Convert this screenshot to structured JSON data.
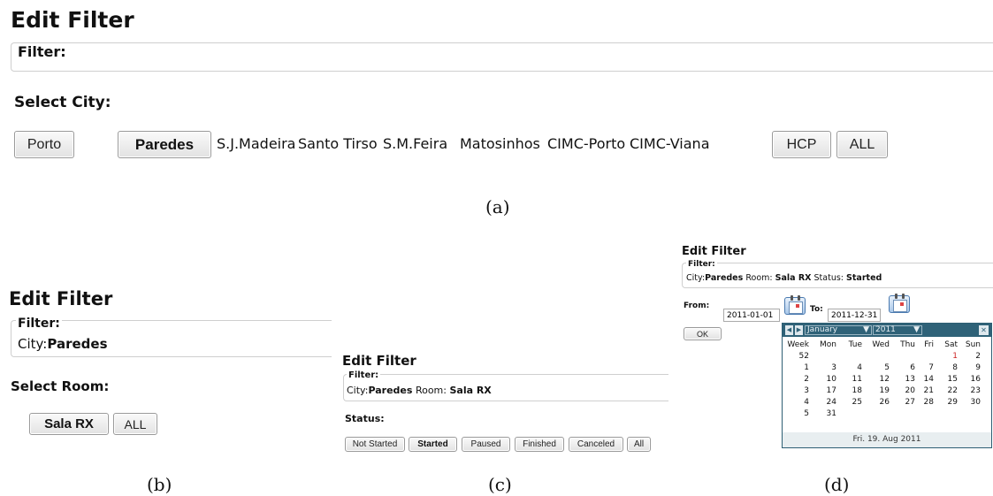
{
  "panel_a": {
    "title": "Edit Filter",
    "filter_legend": "Filter:",
    "section_label": "Select City:",
    "cities": [
      {
        "label": "Porto",
        "style": "button"
      },
      {
        "label": "Paredes",
        "style": "button-bold"
      },
      {
        "label": "S.J.Madeira",
        "style": "text"
      },
      {
        "label": "Santo Tirso",
        "style": "text"
      },
      {
        "label": "S.M.Feira",
        "style": "text"
      },
      {
        "label": "Matosinhos",
        "style": "text"
      },
      {
        "label": "CIMC-Porto",
        "style": "text"
      },
      {
        "label": "CIMC-Viana",
        "style": "text"
      },
      {
        "label": "HCP",
        "style": "button"
      },
      {
        "label": "ALL",
        "style": "button"
      }
    ],
    "caption": "(a)"
  },
  "panel_b": {
    "title": "Edit Filter",
    "filter_legend": "Filter:",
    "filter_city_key": "City:",
    "filter_city_value": "Paredes",
    "section_label": "Select Room:",
    "rooms": [
      "Sala RX",
      "ALL"
    ],
    "caption": "(b)"
  },
  "panel_c": {
    "title": "Edit Filter",
    "filter_legend": "Filter:",
    "filter_city_key": "City:",
    "filter_city_value": "Paredes",
    "filter_room_key": "Room:",
    "filter_room_value": "Sala RX",
    "section_label": "Status:",
    "statuses": [
      "Not Started",
      "Started",
      "Paused",
      "Finished",
      "Canceled",
      "All"
    ],
    "selected_status": "Started",
    "caption": "(c)"
  },
  "panel_d": {
    "title": "Edit Filter",
    "filter_legend": "Filter:",
    "filter_city_key": "City:",
    "filter_city_value": "Paredes",
    "filter_room_key": "Room:",
    "filter_room_value": "Sala RX",
    "filter_status_key": "Status:",
    "filter_status_value": "Started",
    "from_label": "From:",
    "from_value": "2011-01-01",
    "to_label": "To:",
    "to_value": "2011-12-31",
    "ok_label": "OK",
    "calendar": {
      "month": "January",
      "year": "2011",
      "close": "✕",
      "headers": [
        "Week",
        "Mon",
        "Tue",
        "Wed",
        "Thu",
        "Fri",
        "Sat",
        "Sun"
      ],
      "rows": [
        [
          "52",
          "",
          "",
          "",
          "",
          "",
          "1",
          "2"
        ],
        [
          "1",
          "3",
          "4",
          "5",
          "6",
          "7",
          "8",
          "9"
        ],
        [
          "2",
          "10",
          "11",
          "12",
          "13",
          "14",
          "15",
          "16"
        ],
        [
          "3",
          "17",
          "18",
          "19",
          "20",
          "21",
          "22",
          "23"
        ],
        [
          "4",
          "24",
          "25",
          "26",
          "27",
          "28",
          "29",
          "30"
        ],
        [
          "5",
          "31",
          "",
          "",
          "",
          "",
          "",
          ""
        ]
      ],
      "highlight_day": "1",
      "highlight_color": "#cc2222",
      "footer": "Fri. 19. Aug 2011",
      "header_color": "#2f6278"
    },
    "caption": "(d)"
  }
}
